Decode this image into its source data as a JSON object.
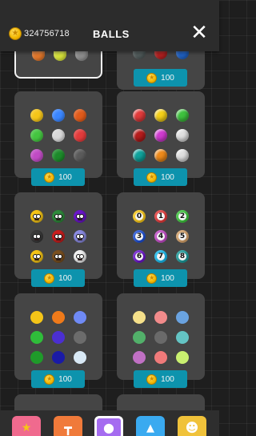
{
  "header": {
    "coins": "324756718",
    "title": "BALLS",
    "close_label": "✕"
  },
  "price_label": "100",
  "skins": [
    {
      "id": "top-left",
      "state": "selected",
      "colors": [
        "#e0762a",
        "#d4e03a",
        "#8c8c8c"
      ]
    },
    {
      "id": "top-right",
      "state": "locked",
      "price": "100",
      "colors": [
        "#505a5a",
        "#b02020",
        "#2060c0"
      ]
    },
    {
      "id": "classic",
      "state": "locked",
      "price": "100",
      "colors": [
        "#f5c518",
        "#3a86ff",
        "#e05a1a",
        "#44c540",
        "#d8d8d8",
        "#e23b3b",
        "#c04bc4",
        "#1c8a2a",
        "#5a5a5a"
      ]
    },
    {
      "id": "glossy",
      "state": "locked",
      "price": "100",
      "colors": [
        "#e23b3b",
        "#f5d018",
        "#3ec23e",
        "#b71c1c",
        "#d13bd1",
        "#e0e0e0",
        "#0fa39c",
        "#ef8a1a",
        "#e0e0e0"
      ]
    },
    {
      "id": "monsters",
      "state": "locked",
      "price": "100",
      "colors": [
        "#f5c518",
        "#2f8a3c",
        "#6a16c9",
        "#3a3a3a",
        "#c81e1e",
        "#8a8ae0",
        "#f5c518",
        "#7a5020",
        "#f0f0f0"
      ]
    },
    {
      "id": "numbers",
      "state": "locked",
      "price": "100",
      "numbers": [
        "0",
        "1",
        "2",
        "3",
        "4",
        "5",
        "6",
        "7",
        "8"
      ],
      "colors": [
        "#f5c518",
        "#e23b3b",
        "#3ec23e",
        "#1f4fd1",
        "#c04bc4",
        "#d2a06a",
        "#6a16c9",
        "#19b7e8",
        "#1d9a9a"
      ]
    },
    {
      "id": "mixed",
      "state": "locked",
      "price": "100",
      "colors": [
        "#f5c518",
        "#ef7a1a",
        "#6f8af5",
        "#2fbd3a",
        "#4b2fd1",
        "#6c6c6c",
        "#1f9a2a",
        "#1a1aa6",
        "#d8e8f5"
      ]
    },
    {
      "id": "pastel",
      "state": "locked",
      "price": "100",
      "colors": [
        "#f5e08a",
        "#f28b8b",
        "#6aa3e0",
        "#52b06a",
        "#6a6a6a",
        "#64c4c4",
        "#c070c4",
        "#f07a7a",
        "#c9f070"
      ]
    }
  ],
  "tabs": [
    {
      "name": "star",
      "icon": "★",
      "color": "#f06a8e",
      "active": false
    },
    {
      "name": "skittle",
      "icon": "┳",
      "color": "#f07a3a",
      "active": false
    },
    {
      "name": "ball",
      "icon": "●",
      "color": "#a56cf0",
      "active": true
    },
    {
      "name": "mountains",
      "icon": "▲",
      "color": "#3aaaf0",
      "active": false
    },
    {
      "name": "character",
      "icon": "☻",
      "color": "#f0c23a",
      "active": false
    }
  ]
}
